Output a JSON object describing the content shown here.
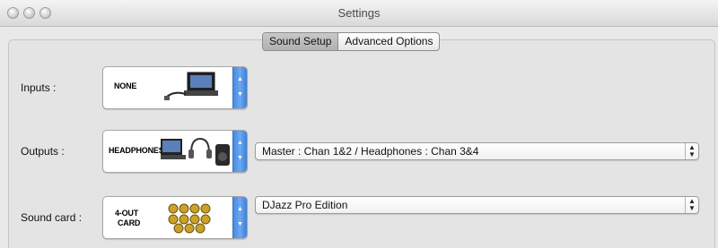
{
  "window": {
    "title": "Settings"
  },
  "tabs": [
    {
      "label": "Sound Setup",
      "selected": true
    },
    {
      "label": "Advanced Options",
      "selected": false
    }
  ],
  "rows": {
    "inputs": {
      "label": "Inputs :",
      "device_text": "NONE",
      "device_icon": "laptop-with-cable-icon"
    },
    "outputs": {
      "label": "Outputs :",
      "device_text": "HEADPHONES",
      "device_icon": "laptop-headphones-speaker-icon",
      "select_value": "Master : Chan 1&2 / Headphones : Chan 3&4"
    },
    "soundcard": {
      "label": "Sound card :",
      "device_text_line1": "4-OUT",
      "device_text_line2": "CARD",
      "device_icon": "rca-connectors-icon",
      "select_value": "DJazz Pro Edition"
    }
  },
  "colors": {
    "stepper_blue": "#4a8be0",
    "window_bg": "#e9e9e9"
  }
}
